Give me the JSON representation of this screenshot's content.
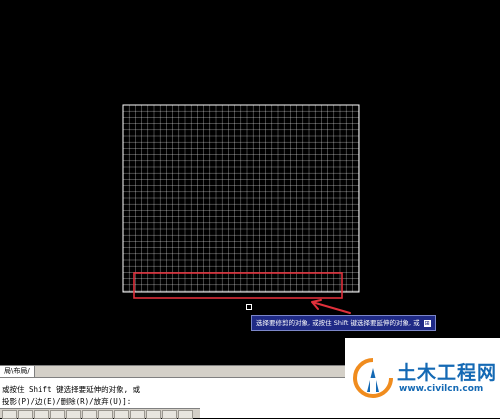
{
  "canvas": {
    "background": "#000000",
    "grid_color": "#ffffff",
    "highlight_color": "#e0303b"
  },
  "tooltip": {
    "text": "选择要修剪的对象, 或按住 Shift 键选择要延伸的对象, 或",
    "icon": "expand-icon",
    "icon_glyph": "⊞",
    "background": "#1f2a86"
  },
  "layout_tab": {
    "label": "局\\布局/"
  },
  "command_line": {
    "line1": "或按住 Shift 键选择要延伸的对象, 或",
    "line2": "投影(P)/边(E)/删除(R)/放弃(U)]:"
  },
  "watermark": {
    "title": "土木工程网",
    "url": "www.civilcn.com",
    "brand_color": "#1469b4"
  }
}
